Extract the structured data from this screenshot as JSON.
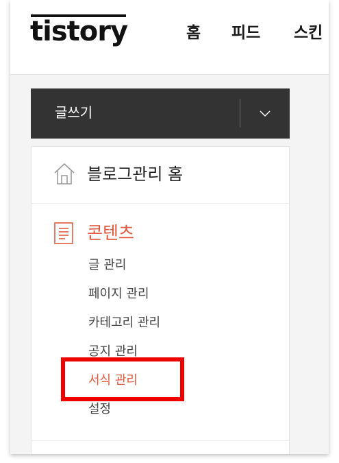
{
  "header": {
    "logo_text": "tistory",
    "nav": [
      {
        "label": "홈"
      },
      {
        "label": "피드"
      },
      {
        "label": "스킨"
      }
    ]
  },
  "write": {
    "label": "글쓰기",
    "toggle_icon": "chevron-down-icon"
  },
  "menu": {
    "home": {
      "label": "블로그관리 홈",
      "icon": "house-icon"
    },
    "content": {
      "label": "콘텐츠",
      "icon": "document-icon",
      "items": [
        {
          "label": "글 관리"
        },
        {
          "label": "페이지 관리"
        },
        {
          "label": "카테고리 관리"
        },
        {
          "label": "공지 관리"
        },
        {
          "label": "서식 관리"
        },
        {
          "label": "설정"
        }
      ],
      "active_label": "서식 관리"
    }
  },
  "colors": {
    "accent": "#e15a3f",
    "highlight": "#f10000",
    "write_bar": "#333333"
  }
}
